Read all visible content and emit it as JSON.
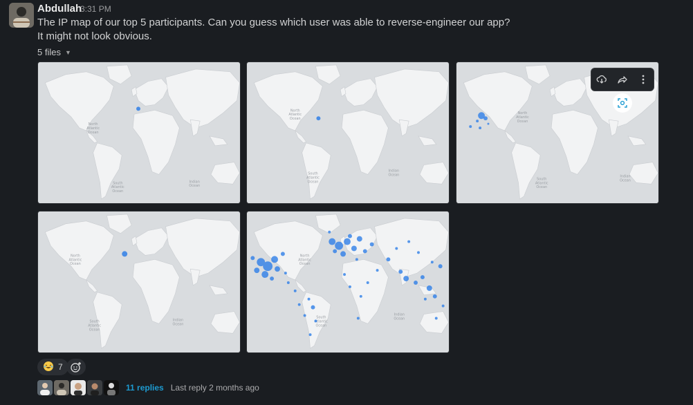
{
  "message": {
    "author": "Abdullah",
    "time": "3:31 PM",
    "line1": "The IP map of our top 5 participants. Can you guess which user was able to reverse-engineer our app?",
    "line2": "It might not look obvious.",
    "files_label": "5 files"
  },
  "map_labels": {
    "north_atlantic": [
      "North",
      "Atlantic",
      "Ocean"
    ],
    "south_atlantic": [
      "South",
      "Atlantic",
      "Ocean"
    ],
    "indian": [
      "Indian",
      "Ocean"
    ]
  },
  "reactions": [
    {
      "icon": "laughing-emoji",
      "count": "7"
    }
  ],
  "thread": {
    "replies": "11 replies",
    "last_reply": "Last reply 2 months ago"
  },
  "colors": {
    "accent": "#1d9bd1",
    "dot": "#2f7fe8",
    "land": "#f2f3f4",
    "water": "#d9dcdf"
  }
}
